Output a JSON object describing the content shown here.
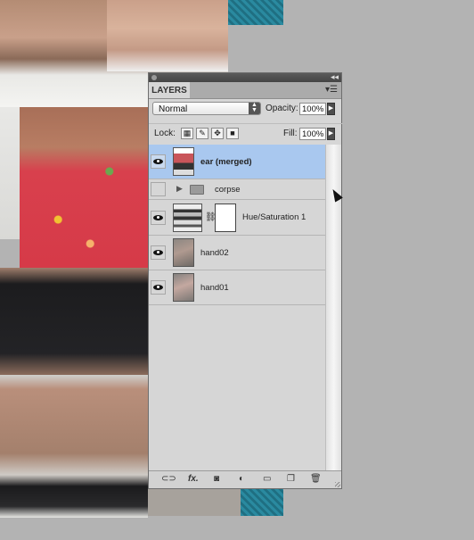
{
  "panel": {
    "tab_label": "LAYERS",
    "blend_mode": "Normal",
    "opacity_label": "Opacity:",
    "opacity_value": "100%",
    "lock_label": "Lock:",
    "fill_label": "Fill:",
    "fill_value": "100%"
  },
  "layers": [
    {
      "name": "ear (merged)",
      "visible": true,
      "selected": true,
      "kind": "pixel"
    },
    {
      "name": "corpse",
      "visible": false,
      "selected": false,
      "kind": "group"
    },
    {
      "name": "Hue/Saturation 1",
      "visible": true,
      "selected": false,
      "kind": "adjustment"
    },
    {
      "name": "hand02",
      "visible": true,
      "selected": false,
      "kind": "pixel"
    },
    {
      "name": "hand01",
      "visible": true,
      "selected": false,
      "kind": "pixel"
    }
  ],
  "bottom_toolbar": [
    "link-icon",
    "fx-icon",
    "mask-icon",
    "adjustment-icon",
    "folder-icon",
    "new-layer-icon",
    "trash-icon"
  ],
  "bottom_toolbar_glyphs": {
    "fx": "fx."
  },
  "colors": {
    "selection": "#a9c8ef",
    "panel_bg": "#d6d6d6"
  }
}
